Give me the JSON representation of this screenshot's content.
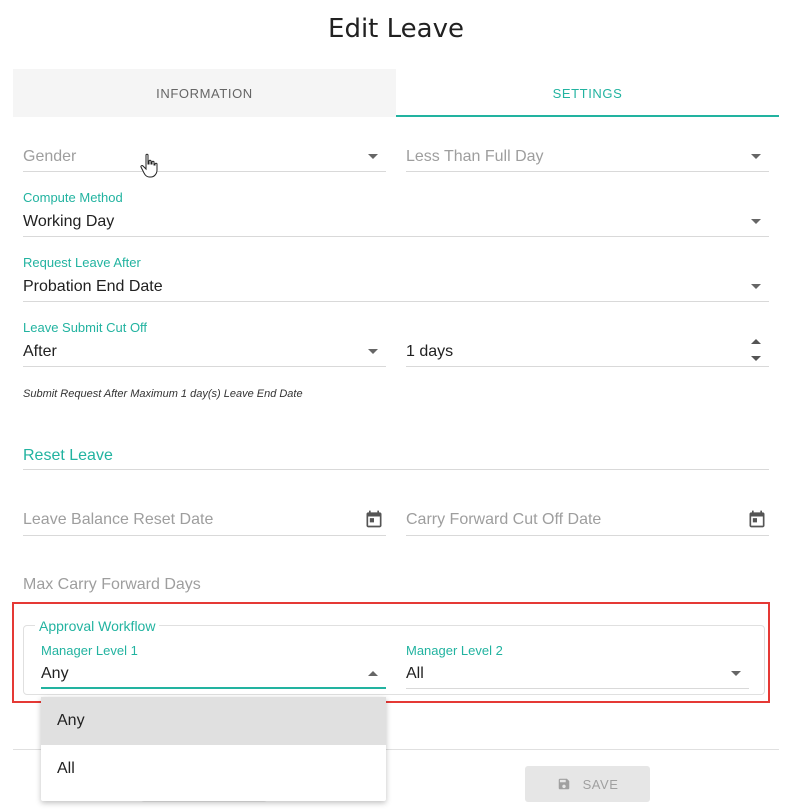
{
  "page": {
    "title": "Edit Leave"
  },
  "tabs": [
    {
      "label": "INFORMATION",
      "active": false
    },
    {
      "label": "SETTINGS",
      "active": true
    }
  ],
  "form": {
    "gender": {
      "placeholder": "Gender"
    },
    "less_than_full_day": {
      "placeholder": "Less Than Full Day"
    },
    "compute_method": {
      "label": "Compute Method",
      "value": "Working Day"
    },
    "request_leave_after": {
      "label": "Request Leave After",
      "value": "Probation End Date"
    },
    "leave_submit_cut_off": {
      "label": "Leave Submit Cut Off",
      "value": "After"
    },
    "cut_off_days": {
      "value": "1 days"
    },
    "hint": "Submit Request After Maximum 1 day(s) Leave End Date",
    "reset_section": "Reset Leave",
    "leave_balance_reset_date": {
      "placeholder": "Leave Balance Reset Date"
    },
    "carry_forward_cut_off_date": {
      "placeholder": "Carry Forward Cut Off Date"
    },
    "max_carry_forward_days": {
      "placeholder": "Max Carry Forward Days"
    }
  },
  "approval": {
    "legend": "Approval Workflow",
    "manager_level_1": {
      "label": "Manager Level 1",
      "value": "Any"
    },
    "manager_level_2": {
      "label": "Manager Level 2",
      "value": "All"
    },
    "dropdown_options": [
      "Any",
      "All"
    ],
    "dropdown_selected": "Any"
  },
  "footer": {
    "save_label": "SAVE"
  },
  "colors": {
    "accent": "#22b3a0",
    "highlight_box": "#e53935"
  },
  "icons": [
    "calendar-icon",
    "save-icon",
    "pointer-cursor-icon"
  ]
}
